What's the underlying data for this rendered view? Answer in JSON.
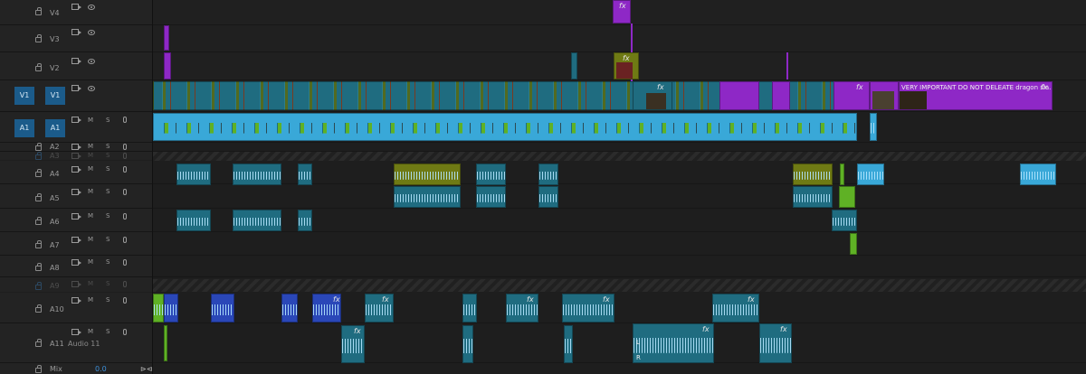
{
  "video_tracks": [
    {
      "id": "V4",
      "label": "V4"
    },
    {
      "id": "V3",
      "label": "V3"
    },
    {
      "id": "V2",
      "label": "V2"
    },
    {
      "id": "V1",
      "label": "V1",
      "source": "V1"
    }
  ],
  "audio_tracks": [
    {
      "id": "A1",
      "label": "A1",
      "source": "A1"
    },
    {
      "id": "A2",
      "label": "A2"
    },
    {
      "id": "A3",
      "label": "A3"
    },
    {
      "id": "A4",
      "label": "A4"
    },
    {
      "id": "A5",
      "label": "A5"
    },
    {
      "id": "A6",
      "label": "A6"
    },
    {
      "id": "A7",
      "label": "A7"
    },
    {
      "id": "A8",
      "label": "A8"
    },
    {
      "id": "A9",
      "label": "A9"
    },
    {
      "id": "A10",
      "label": "A10"
    },
    {
      "id": "A11",
      "label": "A11",
      "name": "Audio 11"
    }
  ],
  "buttons": {
    "mute": "M",
    "solo": "S"
  },
  "mix": {
    "label": "Mix",
    "value": "0.0"
  },
  "clip_labels": {
    "fx": "fx",
    "v1_important": "VERY IMPORTANT DO NOT DELEATE dragon sla...",
    "left_channel": "L",
    "right_channel": "R"
  },
  "colors": {
    "clip_teal": "#1f6c80",
    "clip_aqua": "#39a8d8",
    "clip_violet": "#8e28c6",
    "clip_olive": "#6f7a14",
    "clip_green": "#5fb125",
    "clip_royal": "#2a47b8",
    "track_source_blue": "#1b5b8a",
    "mix_value": "#3d8fd8"
  }
}
